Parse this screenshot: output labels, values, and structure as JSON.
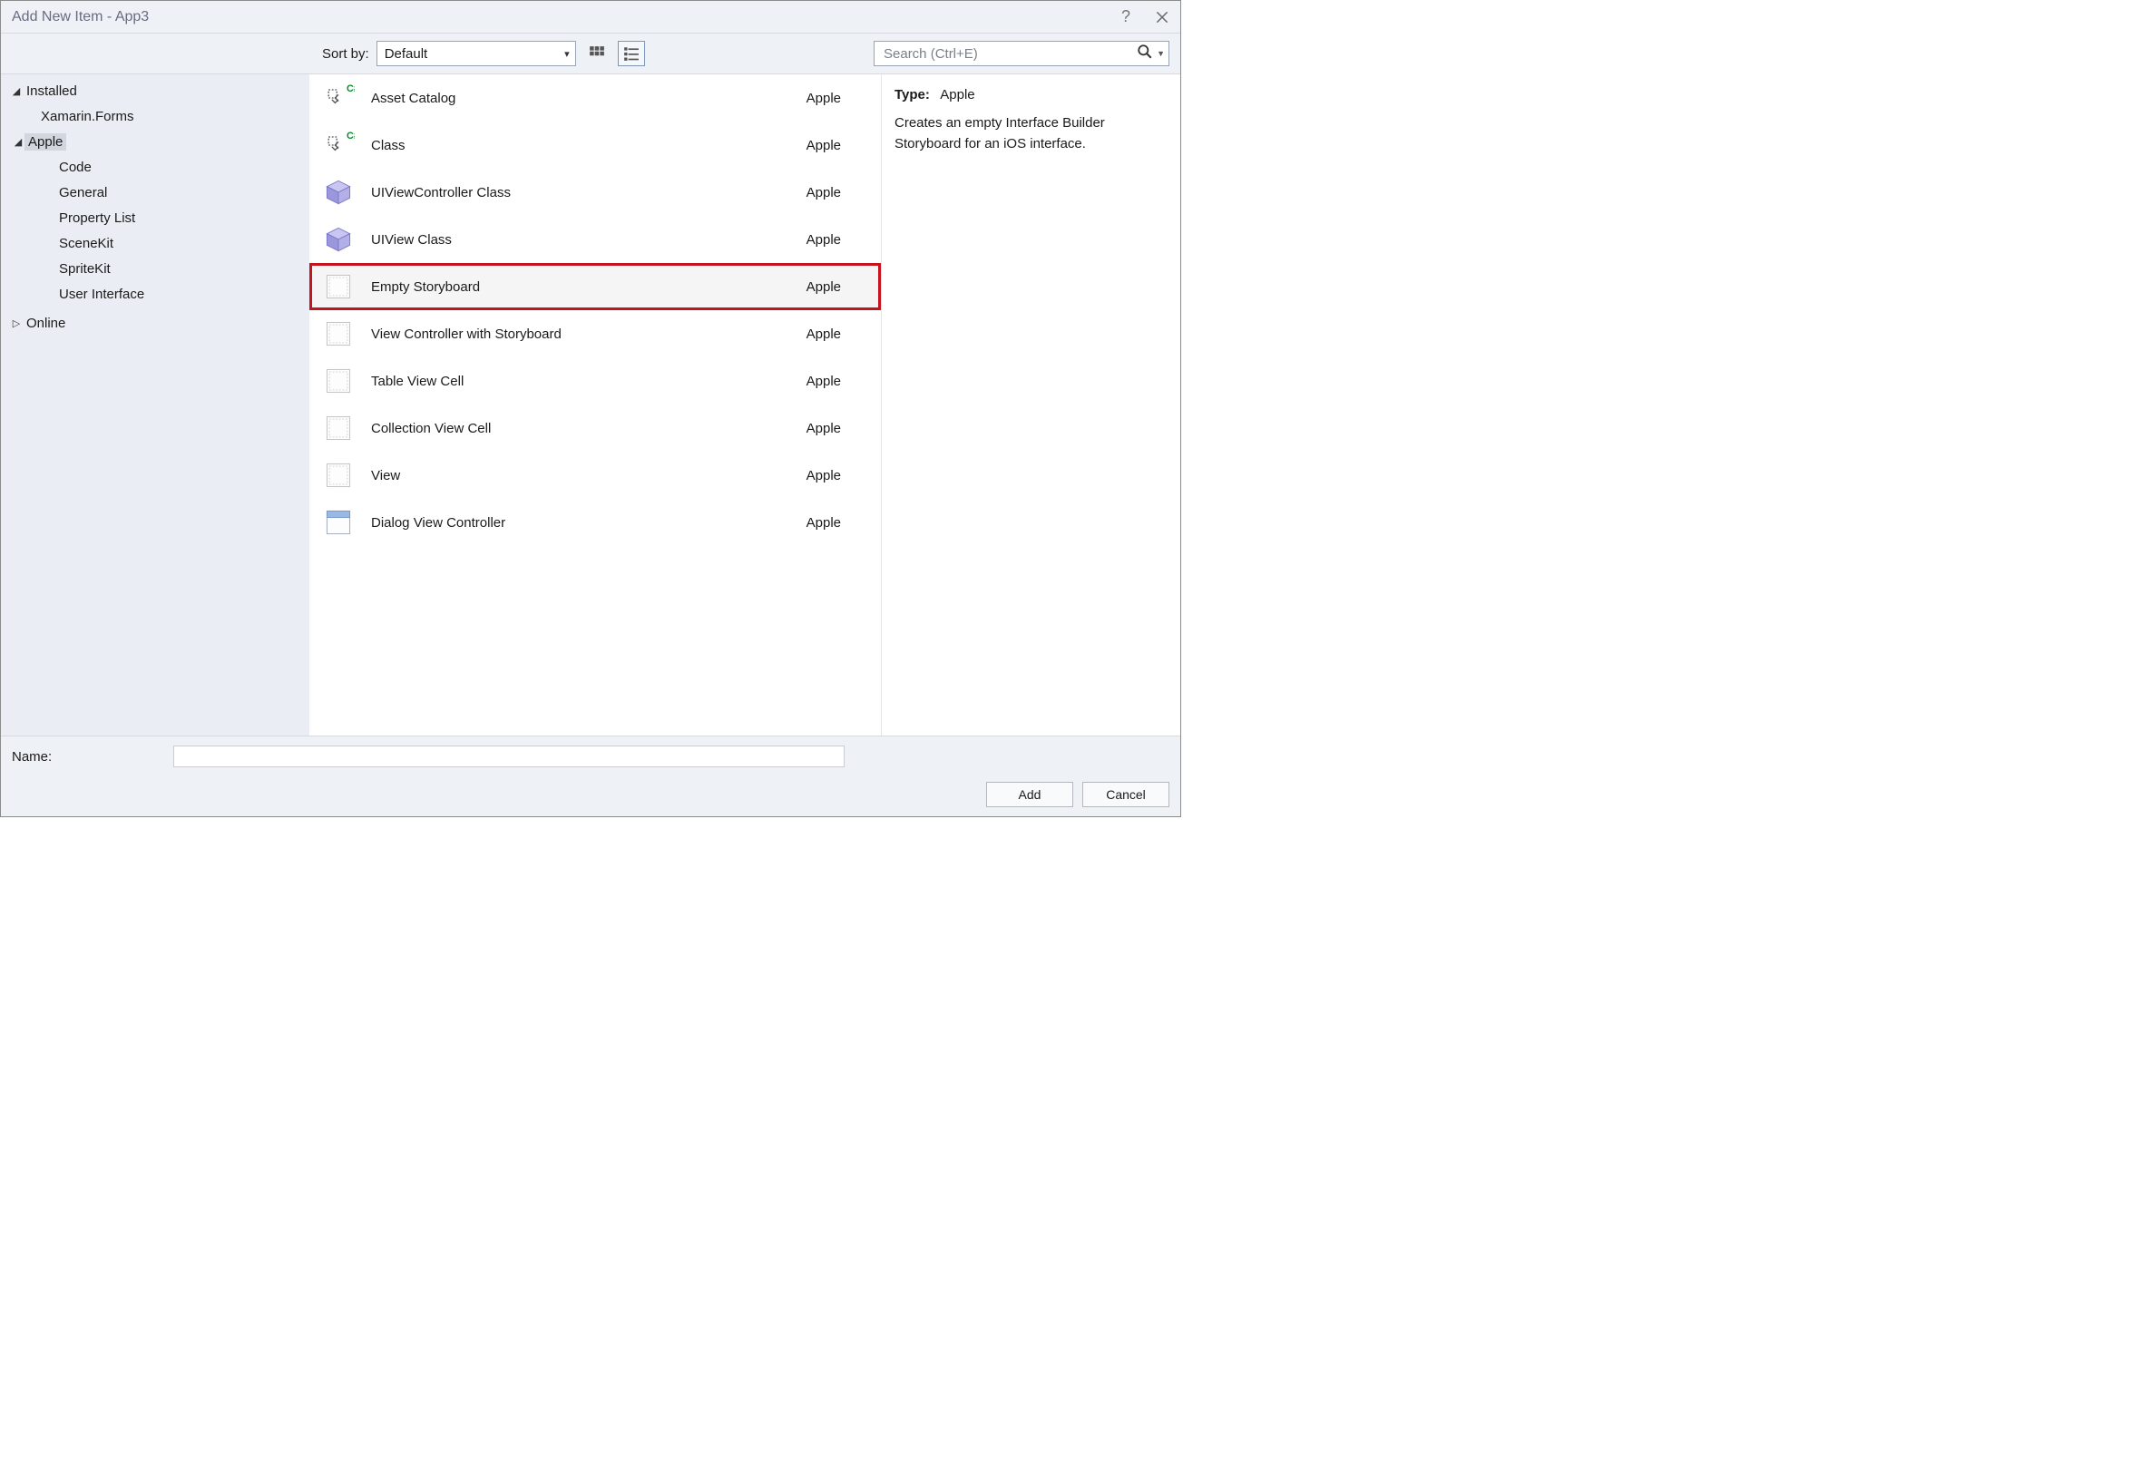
{
  "window": {
    "title": "Add New Item - App3"
  },
  "toolbar": {
    "sort_label": "Sort by:",
    "sort_value": "Default",
    "search_placeholder": "Search (Ctrl+E)"
  },
  "tree": {
    "root": "Installed",
    "items": [
      {
        "label": "Xamarin.Forms",
        "level": 1,
        "expanded": null
      },
      {
        "label": "Apple",
        "level": 1,
        "expanded": true,
        "selected": true
      },
      {
        "label": "Code",
        "level": 2
      },
      {
        "label": "General",
        "level": 2
      },
      {
        "label": "Property List",
        "level": 2
      },
      {
        "label": "SceneKit",
        "level": 2
      },
      {
        "label": "SpriteKit",
        "level": 2
      },
      {
        "label": "User Interface",
        "level": 2
      }
    ],
    "online": "Online"
  },
  "templates": [
    {
      "name": "Asset Catalog",
      "category": "Apple",
      "icon": "asset"
    },
    {
      "name": "Class",
      "category": "Apple",
      "icon": "asset"
    },
    {
      "name": "UIViewController Class",
      "category": "Apple",
      "icon": "cube"
    },
    {
      "name": "UIView Class",
      "category": "Apple",
      "icon": "cube"
    },
    {
      "name": "Empty Storyboard",
      "category": "Apple",
      "icon": "storyboard",
      "selected": true
    },
    {
      "name": "View Controller with Storyboard",
      "category": "Apple",
      "icon": "storyboard"
    },
    {
      "name": "Table View Cell",
      "category": "Apple",
      "icon": "storyboard"
    },
    {
      "name": "Collection View Cell",
      "category": "Apple",
      "icon": "storyboard"
    },
    {
      "name": "View",
      "category": "Apple",
      "icon": "storyboard"
    },
    {
      "name": "Dialog View Controller",
      "category": "Apple",
      "icon": "dialog"
    }
  ],
  "details": {
    "type_label": "Type:",
    "type_value": "Apple",
    "description": "Creates an empty Interface Builder Storyboard for an iOS interface."
  },
  "footer": {
    "name_label": "Name:",
    "name_value": "",
    "add_label": "Add",
    "cancel_label": "Cancel"
  }
}
